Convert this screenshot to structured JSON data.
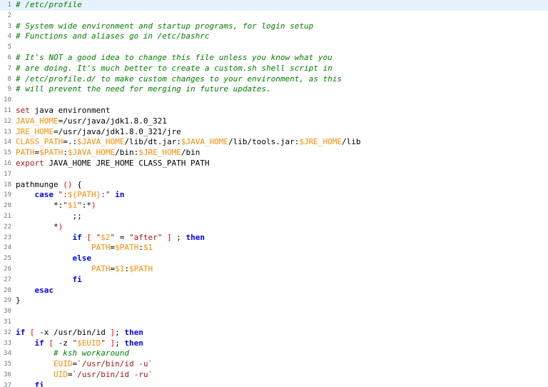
{
  "editor": {
    "colors": {
      "comment": "#008000",
      "keyword": "#0000ff",
      "builtin": "#a31515",
      "variable": "#ff8c00",
      "string": "#a31515",
      "operator": "#ff0000",
      "current_line": "#e8f2fe"
    },
    "current_line": 1,
    "lines": [
      {
        "n": "1",
        "t": [
          {
            "c": "comment",
            "s": "# /etc/profile"
          }
        ]
      },
      {
        "n": "2",
        "t": []
      },
      {
        "n": "3",
        "t": [
          {
            "c": "comment",
            "s": "# System wide environment and startup programs, for login setup"
          }
        ]
      },
      {
        "n": "4",
        "t": [
          {
            "c": "comment",
            "s": "# Functions and aliases go in /etc/bashrc"
          }
        ]
      },
      {
        "n": "5",
        "t": []
      },
      {
        "n": "6",
        "t": [
          {
            "c": "comment",
            "s": "# It's NOT a good idea to change this file unless you know what you"
          }
        ]
      },
      {
        "n": "7",
        "t": [
          {
            "c": "comment",
            "s": "# are doing. It's much better to create a custom.sh shell script in"
          }
        ]
      },
      {
        "n": "8",
        "t": [
          {
            "c": "comment",
            "s": "# /etc/profile.d/ to make custom changes to your environment, as this"
          }
        ]
      },
      {
        "n": "9",
        "t": [
          {
            "c": "comment",
            "s": "# will prevent the need for merging in future updates."
          }
        ]
      },
      {
        "n": "10",
        "t": []
      },
      {
        "n": "11",
        "t": [
          {
            "c": "builtin",
            "s": "set"
          },
          {
            "c": "plain",
            "s": " java environment"
          }
        ]
      },
      {
        "n": "12",
        "t": [
          {
            "c": "var",
            "s": "JAVA_HOME"
          },
          {
            "c": "plain",
            "s": "=/usr/java/jdk1.8.0_321"
          }
        ]
      },
      {
        "n": "13",
        "t": [
          {
            "c": "var",
            "s": "JRE_HOME"
          },
          {
            "c": "plain",
            "s": "=/usr/java/jdk1.8.0_321/jre"
          }
        ]
      },
      {
        "n": "14",
        "t": [
          {
            "c": "var",
            "s": "CLASS_PATH"
          },
          {
            "c": "plain",
            "s": "=.:"
          },
          {
            "c": "var",
            "s": "$JAVA_HOME"
          },
          {
            "c": "plain",
            "s": "/lib/dt.jar:"
          },
          {
            "c": "var",
            "s": "$JAVA_HOME"
          },
          {
            "c": "plain",
            "s": "/lib/tools.jar:"
          },
          {
            "c": "var",
            "s": "$JRE_HOME"
          },
          {
            "c": "plain",
            "s": "/lib"
          }
        ]
      },
      {
        "n": "15",
        "t": [
          {
            "c": "var",
            "s": "PATH"
          },
          {
            "c": "plain",
            "s": "="
          },
          {
            "c": "var",
            "s": "$PATH"
          },
          {
            "c": "plain",
            "s": ":"
          },
          {
            "c": "var",
            "s": "$JAVA_HOME"
          },
          {
            "c": "plain",
            "s": "/bin:"
          },
          {
            "c": "var",
            "s": "$JRE_HOME"
          },
          {
            "c": "plain",
            "s": "/bin"
          }
        ]
      },
      {
        "n": "16",
        "t": [
          {
            "c": "builtin",
            "s": "export"
          },
          {
            "c": "plain",
            "s": " JAVA_HOME JRE_HOME CLASS_PATH PATH"
          }
        ]
      },
      {
        "n": "17",
        "t": []
      },
      {
        "n": "18",
        "t": [
          {
            "c": "plain",
            "s": "pathmunge "
          },
          {
            "c": "op",
            "s": "()"
          },
          {
            "c": "plain",
            "s": " {"
          }
        ]
      },
      {
        "n": "19",
        "t": [
          {
            "c": "plain",
            "s": "    "
          },
          {
            "c": "keyword",
            "s": "case"
          },
          {
            "c": "plain",
            "s": " "
          },
          {
            "c": "string",
            "s": "\":"
          },
          {
            "c": "var",
            "s": "${PATH}"
          },
          {
            "c": "string",
            "s": ":\""
          },
          {
            "c": "plain",
            "s": " "
          },
          {
            "c": "keyword",
            "s": "in"
          }
        ]
      },
      {
        "n": "20",
        "t": [
          {
            "c": "plain",
            "s": "        *:"
          },
          {
            "c": "string",
            "s": "\""
          },
          {
            "c": "var",
            "s": "$1"
          },
          {
            "c": "string",
            "s": "\""
          },
          {
            "c": "plain",
            "s": ":*"
          },
          {
            "c": "op",
            "s": ")"
          }
        ]
      },
      {
        "n": "21",
        "t": [
          {
            "c": "plain",
            "s": "            ;;"
          }
        ]
      },
      {
        "n": "22",
        "t": [
          {
            "c": "plain",
            "s": "        *"
          },
          {
            "c": "op",
            "s": ")"
          }
        ]
      },
      {
        "n": "23",
        "t": [
          {
            "c": "plain",
            "s": "            "
          },
          {
            "c": "keyword",
            "s": "if"
          },
          {
            "c": "plain",
            "s": " "
          },
          {
            "c": "op",
            "s": "["
          },
          {
            "c": "plain",
            "s": " "
          },
          {
            "c": "string",
            "s": "\""
          },
          {
            "c": "var",
            "s": "$2"
          },
          {
            "c": "string",
            "s": "\""
          },
          {
            "c": "plain",
            "s": " = "
          },
          {
            "c": "string",
            "s": "\"after\""
          },
          {
            "c": "plain",
            "s": " "
          },
          {
            "c": "op",
            "s": "]"
          },
          {
            "c": "plain",
            "s": " ; "
          },
          {
            "c": "keyword",
            "s": "then"
          }
        ]
      },
      {
        "n": "24",
        "t": [
          {
            "c": "plain",
            "s": "                "
          },
          {
            "c": "var",
            "s": "PATH"
          },
          {
            "c": "plain",
            "s": "="
          },
          {
            "c": "var",
            "s": "$PATH"
          },
          {
            "c": "plain",
            "s": ":"
          },
          {
            "c": "var",
            "s": "$1"
          }
        ]
      },
      {
        "n": "25",
        "t": [
          {
            "c": "plain",
            "s": "            "
          },
          {
            "c": "keyword",
            "s": "else"
          }
        ]
      },
      {
        "n": "26",
        "t": [
          {
            "c": "plain",
            "s": "                "
          },
          {
            "c": "var",
            "s": "PATH"
          },
          {
            "c": "plain",
            "s": "="
          },
          {
            "c": "var",
            "s": "$1"
          },
          {
            "c": "plain",
            "s": ":"
          },
          {
            "c": "var",
            "s": "$PATH"
          }
        ]
      },
      {
        "n": "27",
        "t": [
          {
            "c": "plain",
            "s": "            "
          },
          {
            "c": "keyword",
            "s": "fi"
          }
        ]
      },
      {
        "n": "28",
        "t": [
          {
            "c": "plain",
            "s": "    "
          },
          {
            "c": "keyword",
            "s": "esac"
          }
        ]
      },
      {
        "n": "29",
        "t": [
          {
            "c": "plain",
            "s": "}"
          }
        ]
      },
      {
        "n": "30",
        "t": []
      },
      {
        "n": "31",
        "t": []
      },
      {
        "n": "32",
        "t": [
          {
            "c": "keyword",
            "s": "if"
          },
          {
            "c": "plain",
            "s": " "
          },
          {
            "c": "op",
            "s": "["
          },
          {
            "c": "plain",
            "s": " -x /usr/bin/id "
          },
          {
            "c": "op",
            "s": "]"
          },
          {
            "c": "plain",
            "s": "; "
          },
          {
            "c": "keyword",
            "s": "then"
          }
        ]
      },
      {
        "n": "33",
        "t": [
          {
            "c": "plain",
            "s": "    "
          },
          {
            "c": "keyword",
            "s": "if"
          },
          {
            "c": "plain",
            "s": " "
          },
          {
            "c": "op",
            "s": "["
          },
          {
            "c": "plain",
            "s": " -z "
          },
          {
            "c": "string",
            "s": "\""
          },
          {
            "c": "var",
            "s": "$EUID"
          },
          {
            "c": "string",
            "s": "\""
          },
          {
            "c": "plain",
            "s": " "
          },
          {
            "c": "op",
            "s": "]"
          },
          {
            "c": "plain",
            "s": "; "
          },
          {
            "c": "keyword",
            "s": "then"
          }
        ]
      },
      {
        "n": "34",
        "t": [
          {
            "c": "plain",
            "s": "        "
          },
          {
            "c": "comment",
            "s": "# ksh workaround"
          }
        ]
      },
      {
        "n": "35",
        "t": [
          {
            "c": "plain",
            "s": "        "
          },
          {
            "c": "var",
            "s": "EUID"
          },
          {
            "c": "plain",
            "s": "="
          },
          {
            "c": "string",
            "s": "`/usr/bin/id -u`"
          }
        ]
      },
      {
        "n": "36",
        "t": [
          {
            "c": "plain",
            "s": "        "
          },
          {
            "c": "var",
            "s": "UID"
          },
          {
            "c": "plain",
            "s": "="
          },
          {
            "c": "string",
            "s": "`/usr/bin/id -ru`"
          }
        ]
      },
      {
        "n": "37",
        "t": [
          {
            "c": "plain",
            "s": "    "
          },
          {
            "c": "keyword",
            "s": "fi"
          }
        ]
      }
    ]
  }
}
